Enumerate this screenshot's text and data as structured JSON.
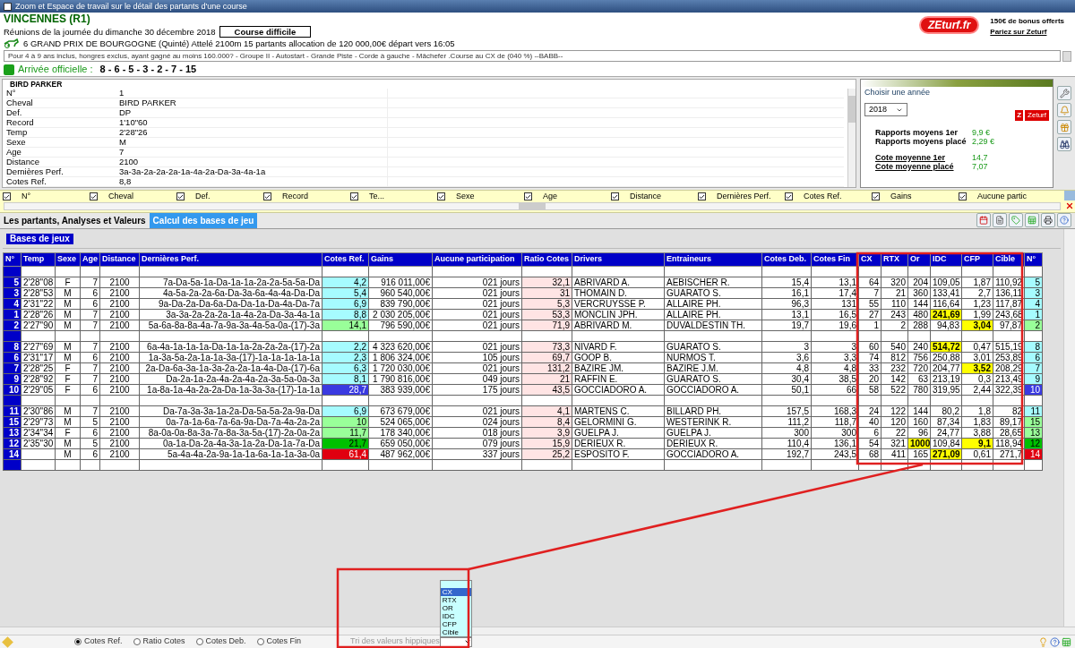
{
  "window": {
    "title": "Zoom et Espace de travail sur le détail des partants d'une course"
  },
  "header": {
    "venue": "VINCENNES (R1)",
    "meeting": "Réunions de la journée du dimanche 30 décembre 2018",
    "difficulty_button": "Course difficile",
    "race": "6 GRAND PRIX DE BOURGOGNE (Quinté) Attelé 2100m 15 partants allocation de 120 000,00€ départ vers 16:05",
    "conditions": "Pour 4 à 9 ans inclus, hongres exclus, ayant gagné au moins 160.000? - Groupe II - Autostart - Grande Piste - Corde à gauche - Mâchefer .Course au CX de (040 %)  --BABB--",
    "arrival_label": "Arrivée officielle :",
    "arrival": "8 - 6 - 5 - 3 - 2 - 7 - 15"
  },
  "promo": {
    "logo": "ZEturf.fr",
    "bonus": "150€ de bonus offerts",
    "link": "Pariez sur Zeturf"
  },
  "horse": {
    "title": "BIRD PARKER",
    "fields": [
      {
        "label": "N°",
        "value": "1"
      },
      {
        "label": "Cheval",
        "value": "BIRD PARKER"
      },
      {
        "label": "Def.",
        "value": "DP"
      },
      {
        "label": "Record",
        "value": "1'10\"60"
      },
      {
        "label": "Temp",
        "value": "2'28\"26"
      },
      {
        "label": "Sexe",
        "value": "M"
      },
      {
        "label": "Age",
        "value": "7"
      },
      {
        "label": "Distance",
        "value": "2100"
      },
      {
        "label": "Dernières Perf.",
        "value": "3a-3a-2a-2a-2a-1a-4a-2a-Da-3a-4a-1a"
      },
      {
        "label": "Cotes Ref.",
        "value": "8,8"
      }
    ]
  },
  "stats": {
    "year_label": "Choisir une année",
    "year": "2018",
    "badge_letter": "Z",
    "badge_text": "Zeturf",
    "rows": [
      {
        "label": "Rapports moyens 1er",
        "value": "9,9 €",
        "kind": "plain"
      },
      {
        "label": "Rapports moyens placé",
        "value": "2,29 €",
        "kind": "plain"
      },
      {
        "label": "Cote moyenne 1er",
        "value": "14,7",
        "kind": "link"
      },
      {
        "label": "Cote moyenne placé",
        "value": "7,07",
        "kind": "link"
      }
    ]
  },
  "column_filters": [
    {
      "label": "N°",
      "checked": true
    },
    {
      "label": "Cheval",
      "checked": true
    },
    {
      "label": "Def.",
      "checked": true
    },
    {
      "label": "Record",
      "checked": true
    },
    {
      "label": "Te...",
      "checked": true
    },
    {
      "label": "Sexe",
      "checked": true
    },
    {
      "label": "Age",
      "checked": true
    },
    {
      "label": "Distance",
      "checked": true
    },
    {
      "label": "Dernières Perf.",
      "checked": true
    },
    {
      "label": "Cotes Ref.",
      "checked": true
    },
    {
      "label": "Gains",
      "checked": true
    },
    {
      "label": "Aucune partic",
      "checked": true
    }
  ],
  "tabs": [
    {
      "label": "Les partants, Analyses et Valeurs",
      "selected": false
    },
    {
      "label": "Calcul des bases de jeu",
      "selected": true
    }
  ],
  "section_title": "Bases de jeux",
  "table": {
    "columns": [
      "N°",
      "Temp",
      "Sexe",
      "Age",
      "Distance",
      "Dernières Perf.",
      "Cotes Ref.",
      "Gains",
      "Aucune participation",
      "Ratio Cotes",
      "Drivers",
      "Entraineurs",
      "Cotes Deb.",
      "Cotes Fin",
      "CX",
      "RTX",
      "Or",
      "IDC",
      "CFP",
      "Cible",
      "N°"
    ],
    "rows": [
      {
        "kind": "spacer"
      },
      {
        "kind": "runner",
        "color": "#a6fbff",
        "highlights": {
          "or": false,
          "idc": false,
          "cfp": false
        },
        "cells": [
          "5",
          "2'28\"08",
          "F",
          "7",
          "2100",
          "7a-Da-5a-1a-Da-1a-1a-2a-2a-5a-5a-Da",
          "4,2",
          "916 011,00€",
          "021 jours",
          "32,1",
          "ABRIVARD A.",
          "AEBISCHER R.",
          "15,4",
          "13,1",
          "64",
          "320",
          "204",
          "109,05",
          "1,87",
          "110,92",
          "5"
        ]
      },
      {
        "kind": "runner",
        "color": "#a6fbff",
        "highlights": {
          "or": false,
          "idc": false,
          "cfp": false
        },
        "cells": [
          "3",
          "2'28\"53",
          "M",
          "6",
          "2100",
          "4a-5a-2a-2a-6a-Da-3a-6a-4a-4a-Da-Da",
          "5,4",
          "960 540,00€",
          "021 jours",
          "31",
          "THOMAIN D.",
          "GUARATO S.",
          "16,1",
          "17,4",
          "7",
          "21",
          "360",
          "133,41",
          "2,7",
          "136,11",
          "3"
        ]
      },
      {
        "kind": "runner",
        "color": "#a6fbff",
        "highlights": {
          "or": false,
          "idc": false,
          "cfp": false
        },
        "cells": [
          "4",
          "2'31\"22",
          "M",
          "6",
          "2100",
          "9a-Da-2a-Da-6a-Da-Da-1a-Da-4a-Da-7a",
          "6,9",
          "839 790,00€",
          "021 jours",
          "5,3",
          "VERCRUYSSE P.",
          "ALLAIRE PH.",
          "96,3",
          "131",
          "55",
          "110",
          "144",
          "116,64",
          "1,23",
          "117,87",
          "4"
        ]
      },
      {
        "kind": "runner",
        "color": "#a6fbff",
        "highlights": {
          "or": false,
          "idc": true,
          "cfp": false
        },
        "cells": [
          "1",
          "2'28\"26",
          "M",
          "7",
          "2100",
          "3a-3a-2a-2a-2a-1a-4a-2a-Da-3a-4a-1a",
          "8,8",
          "2 030 205,00€",
          "021 jours",
          "53,3",
          "MONCLIN JPH.",
          "ALLAIRE PH.",
          "13,1",
          "16,5",
          "27",
          "243",
          "480",
          "241,69",
          "1,99",
          "243,68",
          "1"
        ]
      },
      {
        "kind": "runner",
        "color": "#99ff99",
        "highlights": {
          "or": false,
          "idc": false,
          "cfp": true
        },
        "cells": [
          "2",
          "2'27\"90",
          "M",
          "7",
          "2100",
          "5a-6a-8a-8a-4a-7a-9a-3a-4a-5a-0a-(17)-3a",
          "14,1",
          "796 590,00€",
          "021 jours",
          "71,9",
          "ABRIVARD M.",
          "DUVALDESTIN TH.",
          "19,7",
          "19,6",
          "1",
          "2",
          "288",
          "94,83",
          "3,04",
          "97,87",
          "2"
        ]
      },
      {
        "kind": "spacer"
      },
      {
        "kind": "runner",
        "color": "#a6fbff",
        "highlights": {
          "or": false,
          "idc": true,
          "cfp": false
        },
        "cells": [
          "8",
          "2'27\"69",
          "M",
          "7",
          "2100",
          "6a-4a-1a-1a-1a-Da-1a-1a-2a-2a-2a-(17)-2a",
          "2,2",
          "4 323 620,00€",
          "021 jours",
          "73,3",
          "NIVARD F.",
          "GUARATO S.",
          "3",
          "3",
          "60",
          "540",
          "240",
          "514,72",
          "0,47",
          "515,19",
          "8"
        ]
      },
      {
        "kind": "runner",
        "color": "#a6fbff",
        "highlights": {
          "or": false,
          "idc": false,
          "cfp": false
        },
        "cells": [
          "6",
          "2'31\"17",
          "M",
          "6",
          "2100",
          "1a-3a-5a-2a-1a-1a-3a-(17)-1a-1a-1a-1a-1a",
          "2,3",
          "1 806 324,00€",
          "105 jours",
          "69,7",
          "GOOP B.",
          "NURMOS T.",
          "3,6",
          "3,3",
          "74",
          "812",
          "756",
          "250,88",
          "3,01",
          "253,89",
          "6"
        ]
      },
      {
        "kind": "runner",
        "color": "#a6fbff",
        "highlights": {
          "or": false,
          "idc": false,
          "cfp": true
        },
        "cells": [
          "7",
          "2'28\"25",
          "F",
          "7",
          "2100",
          "2a-Da-6a-3a-1a-3a-2a-2a-1a-4a-Da-(17)-6a",
          "6,3",
          "1 720 030,00€",
          "021 jours",
          "131,2",
          "BAZIRE JM.",
          "BAZIRE J.M.",
          "4,8",
          "4,8",
          "33",
          "232",
          "720",
          "204,77",
          "3,52",
          "208,29",
          "7"
        ]
      },
      {
        "kind": "runner",
        "color": "#a6fbff",
        "highlights": {
          "or": false,
          "idc": false,
          "cfp": false
        },
        "cells": [
          "9",
          "2'28\"92",
          "F",
          "7",
          "2100",
          "Da-2a-1a-2a-4a-2a-4a-2a-3a-5a-0a-3a",
          "8,1",
          "1 790 816,00€",
          "049 jours",
          "21",
          "RAFFIN E.",
          "GUARATO S.",
          "30,4",
          "38,5",
          "20",
          "142",
          "63",
          "213,19",
          "0,3",
          "213,49",
          "9"
        ]
      },
      {
        "kind": "runner",
        "color": "#3a3ae0",
        "highlights": {
          "or": false,
          "idc": false,
          "cfp": false
        },
        "cells": [
          "10",
          "2'29\"05",
          "F",
          "6",
          "2100",
          "1a-8a-1a-4a-2a-2a-Da-1a-3a-3a-(17)-1a-1a",
          "28,7",
          "383 939,00€",
          "175 jours",
          "43,5",
          "GOCCIADORO A.",
          "GOCCIADORO A.",
          "50,1",
          "66",
          "58",
          "522",
          "780",
          "319,95",
          "2,44",
          "322,39",
          "10"
        ]
      },
      {
        "kind": "spacer"
      },
      {
        "kind": "runner",
        "color": "#a6fbff",
        "highlights": {
          "or": false,
          "idc": false,
          "cfp": false
        },
        "cells": [
          "11",
          "2'30\"86",
          "M",
          "7",
          "2100",
          "Da-7a-3a-3a-1a-2a-Da-5a-5a-2a-9a-Da",
          "6,9",
          "673 679,00€",
          "021 jours",
          "4,1",
          "MARTENS C.",
          "BILLARD PH.",
          "157,5",
          "168,3",
          "24",
          "122",
          "144",
          "80,2",
          "1,8",
          "82",
          "11"
        ]
      },
      {
        "kind": "runner",
        "color": "#99ff99",
        "highlights": {
          "or": false,
          "idc": false,
          "cfp": false
        },
        "cells": [
          "15",
          "2'29\"73",
          "M",
          "5",
          "2100",
          "0a-7a-1a-6a-7a-6a-9a-Da-7a-4a-2a-2a",
          "10",
          "524 065,00€",
          "024 jours",
          "8,4",
          "GELORMINI G.",
          "WESTERINK R.",
          "111,2",
          "118,7",
          "40",
          "120",
          "160",
          "87,34",
          "1,83",
          "89,17",
          "15"
        ]
      },
      {
        "kind": "runner",
        "color": "#99ff99",
        "highlights": {
          "or": false,
          "idc": false,
          "cfp": false
        },
        "cells": [
          "13",
          "2'34\"34",
          "F",
          "6",
          "2100",
          "8a-0a-0a-8a-3a-7a-8a-3a-5a-(17)-2a-0a-2a",
          "11,7",
          "178 340,00€",
          "018 jours",
          "3,9",
          "GUELPA J.",
          "GUELPA J.",
          "300",
          "300",
          "6",
          "22",
          "96",
          "24,77",
          "3,88",
          "28,65",
          "13"
        ]
      },
      {
        "kind": "runner",
        "color": "#00c000",
        "highlights": {
          "or": true,
          "idc": false,
          "cfp": true
        },
        "cells": [
          "12",
          "2'35\"30",
          "M",
          "5",
          "2100",
          "0a-1a-Da-2a-4a-3a-1a-2a-Da-1a-7a-Da",
          "21,7",
          "659 050,00€",
          "079 jours",
          "15,9",
          "DERIEUX R.",
          "DERIEUX R.",
          "110,4",
          "136,1",
          "54",
          "321",
          "1000",
          "109,84",
          "9,1",
          "118,94",
          "12"
        ]
      },
      {
        "kind": "runner",
        "color": "#e00010",
        "highlights": {
          "or": false,
          "idc": true,
          "cfp": false
        },
        "cells": [
          "14",
          null,
          "M",
          "6",
          "2100",
          "5a-4a-4a-2a-9a-1a-1a-6a-1a-1a-3a-0a",
          "61,4",
          "487 962,00€",
          "337 jours",
          "25,2",
          "ESPOSITO F.",
          "GOCCIADORO A.",
          "192,7",
          "243,5",
          "68",
          "411",
          "165",
          "271,09",
          "0,61",
          "271,7",
          "14"
        ]
      },
      {
        "kind": "spacer"
      }
    ]
  },
  "sort_modes": [
    {
      "label": "Cotes Ref.",
      "selected": true
    },
    {
      "label": "Ratio Cotes",
      "selected": false
    },
    {
      "label": "Cotes Deb.",
      "selected": false
    },
    {
      "label": "Cotes Fin",
      "selected": false
    }
  ],
  "sort_dropdown": {
    "placeholder": "Tri des valeurs hippiques",
    "expanded": true,
    "options": [
      {
        "label": "CX",
        "selected": true
      },
      {
        "label": "RTX",
        "selected": false
      },
      {
        "label": "OR",
        "selected": false
      },
      {
        "label": "IDC",
        "selected": false
      },
      {
        "label": "CFP",
        "selected": false
      },
      {
        "label": "Cible",
        "selected": false
      }
    ]
  }
}
